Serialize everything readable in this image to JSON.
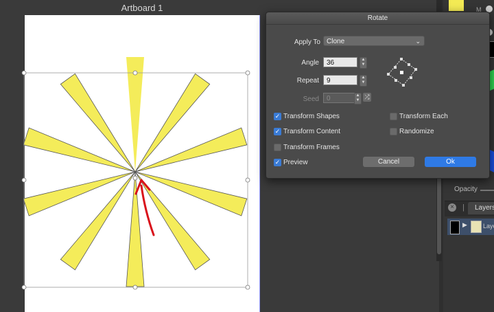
{
  "canvas": {
    "artboard_title": "Artboard 1"
  },
  "right_panel": {
    "m_label": "M",
    "opacity_label": "Opacity",
    "layers_tab": "Layers",
    "layer_name": "Layer"
  },
  "dialog": {
    "title": "Rotate",
    "apply_to_label": "Apply To",
    "apply_to_value": "Clone",
    "angle_label": "Angle",
    "angle_value": "36",
    "repeat_label": "Repeat",
    "repeat_value": "9",
    "seed_label": "Seed",
    "seed_value": "0",
    "checkboxes": {
      "transform_shapes": {
        "label": "Transform Shapes",
        "checked": true
      },
      "transform_content": {
        "label": "Transform Content",
        "checked": true
      },
      "transform_frames": {
        "label": "Transform Frames",
        "checked": false
      },
      "preview": {
        "label": "Preview",
        "checked": true
      },
      "transform_each": {
        "label": "Transform Each",
        "checked": false
      },
      "randomize": {
        "label": "Randomize",
        "checked": false
      }
    },
    "cancel_label": "Cancel",
    "ok_label": "Ok"
  },
  "colors": {
    "ray_fill": "#f4ec5a",
    "ok_button": "#2f7ae5",
    "checkbox_on": "#3a7bd5",
    "annotation": "#d9121b"
  },
  "icons": {
    "stepper": "up-down-arrows",
    "shuffle": "shuffle-icon",
    "chevron": "chevron-down-icon"
  }
}
